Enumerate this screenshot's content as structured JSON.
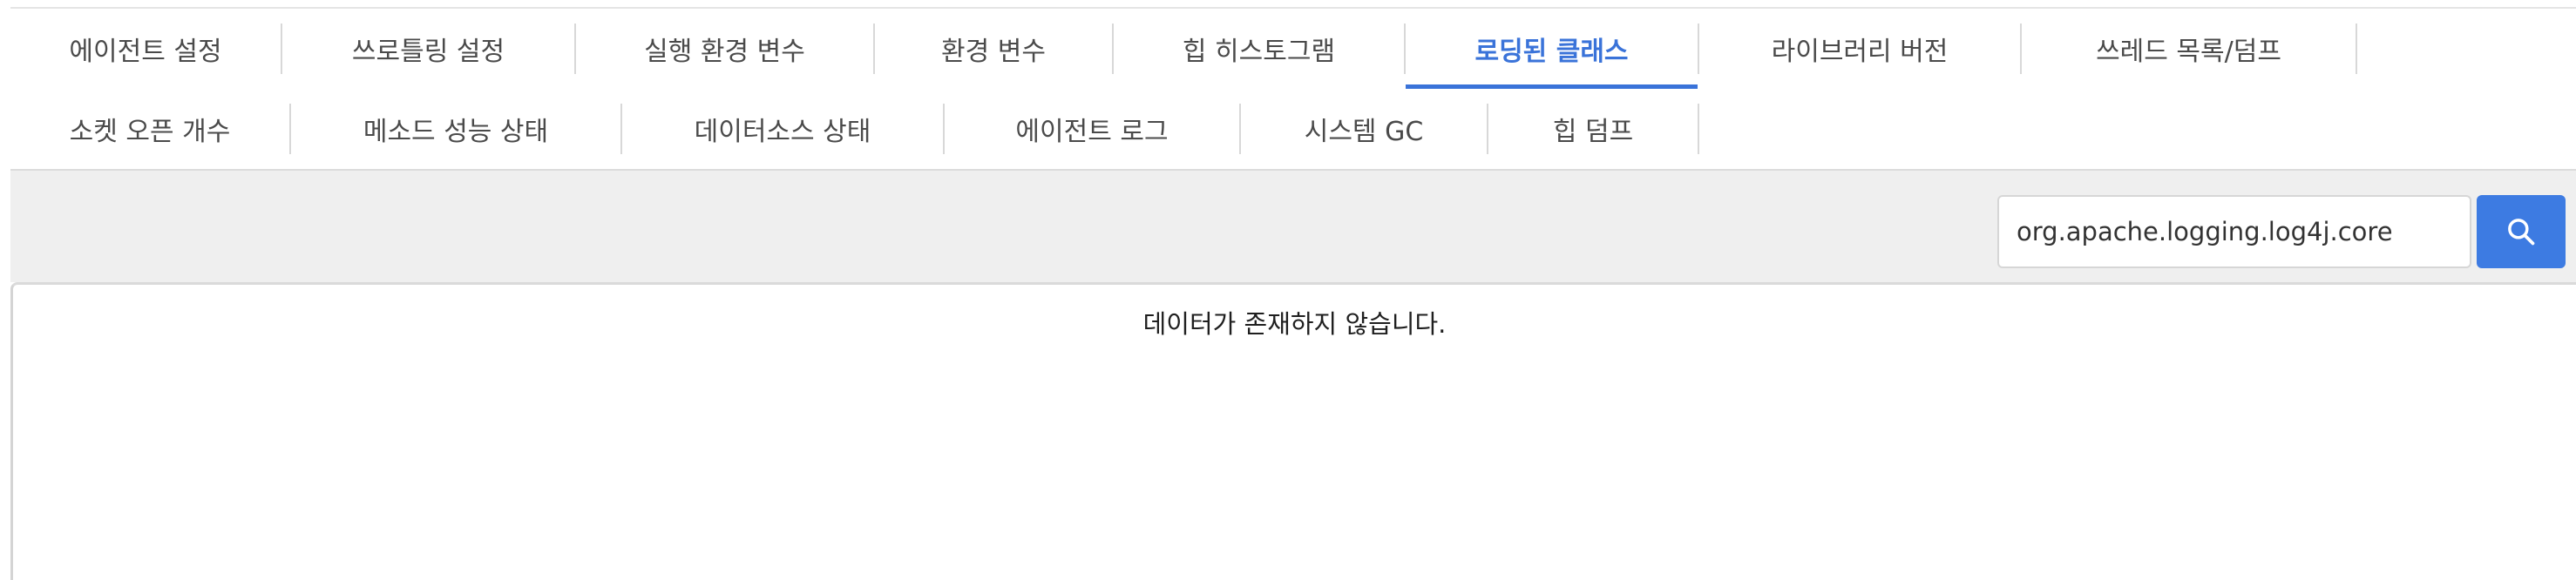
{
  "tabs": {
    "row1": [
      {
        "label": "에이전트 설정"
      },
      {
        "label": "쓰로틀링 설정"
      },
      {
        "label": "실행 환경 변수"
      },
      {
        "label": "환경 변수"
      },
      {
        "label": "힙 히스토그램"
      },
      {
        "label": "로딩된 클래스",
        "active": true
      },
      {
        "label": "라이브러리 버전"
      },
      {
        "label": "쓰레드 목록/덤프"
      }
    ],
    "row2": [
      {
        "label": "소켓 오픈 개수"
      },
      {
        "label": "메소드 성능 상태"
      },
      {
        "label": "데이터소스 상태"
      },
      {
        "label": "에이전트 로그"
      },
      {
        "label": "시스템 GC"
      },
      {
        "label": "힙 덤프"
      }
    ]
  },
  "search": {
    "value": "org.apache.logging.log4j.core",
    "button_icon": "search-icon"
  },
  "content": {
    "empty_message": "데이터가 존재하지 않습니다."
  },
  "colors": {
    "accent": "#3a73d9",
    "toolbar_bg": "#efefef",
    "search_button": "#3d7be2"
  }
}
